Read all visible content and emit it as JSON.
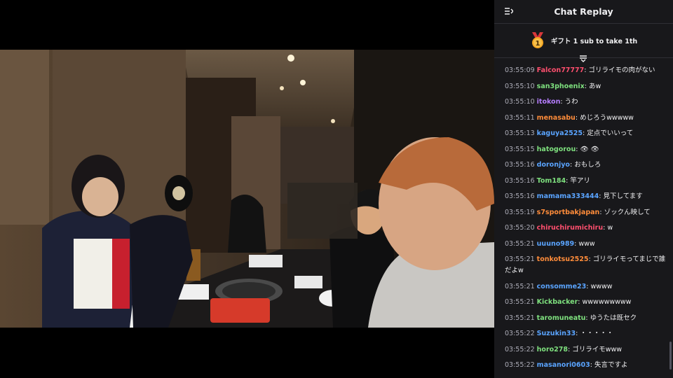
{
  "chat": {
    "title": "Chat Replay",
    "pinned": {
      "badge_number": "1",
      "text": "ギフト 1 sub to take 1th"
    },
    "messages": [
      {
        "time": "03:55:09",
        "user": "Falcon77777",
        "color": "#ff4f6e",
        "text": "ゴリライモの肉がない"
      },
      {
        "time": "03:55:10",
        "user": "san3phoenix",
        "color": "#7ee07e",
        "text": "あw"
      },
      {
        "time": "03:55:10",
        "user": "itokon",
        "color": "#b57dff",
        "text": "うわ"
      },
      {
        "time": "03:55:11",
        "user": "menasabu",
        "color": "#ff8c3a",
        "text": "めじろうwwwww"
      },
      {
        "time": "03:55:13",
        "user": "kaguya2525",
        "color": "#5aa4ff",
        "text": "定点でいいって"
      },
      {
        "time": "03:55:15",
        "user": "hatogorou",
        "color": "#7ee07e",
        "text": "👁 👁"
      },
      {
        "time": "03:55:16",
        "user": "doronjyo",
        "color": "#5aa4ff",
        "text": "おもしろ"
      },
      {
        "time": "03:55:16",
        "user": "Tom184",
        "color": "#7ee07e",
        "text": "竿アリ"
      },
      {
        "time": "03:55:16",
        "user": "mamama333444",
        "color": "#5aa4ff",
        "text": "見下してます"
      },
      {
        "time": "03:55:19",
        "user": "s7sportbakjapan",
        "color": "#ff8c3a",
        "text": "ゾックん映して"
      },
      {
        "time": "03:55:20",
        "user": "chiruchirumichiru",
        "color": "#ff4f6e",
        "text": "w"
      },
      {
        "time": "03:55:21",
        "user": "uuuno989",
        "color": "#5aa4ff",
        "text": "www"
      },
      {
        "time": "03:55:21",
        "user": "tonkotsu2525",
        "color": "#ff8c3a",
        "text": "ゴリライモってまじで誰だよw"
      },
      {
        "time": "03:55:21",
        "user": "consomme23",
        "color": "#5aa4ff",
        "text": "wwww"
      },
      {
        "time": "03:55:21",
        "user": "Kickbacker",
        "color": "#7ee07e",
        "text": "wwwwwwwww"
      },
      {
        "time": "03:55:21",
        "user": "taromuneatu",
        "color": "#7ee07e",
        "text": "ゆうたは既セク"
      },
      {
        "time": "03:55:22",
        "user": "Suzukin33",
        "color": "#5aa4ff",
        "text": "・・・・・"
      },
      {
        "time": "03:55:22",
        "user": "horo278",
        "color": "#7ee07e",
        "text": "ゴリライモwww"
      },
      {
        "time": "03:55:22",
        "user": "masanori0603",
        "color": "#5aa4ff",
        "text": "失言ですよ"
      }
    ]
  }
}
